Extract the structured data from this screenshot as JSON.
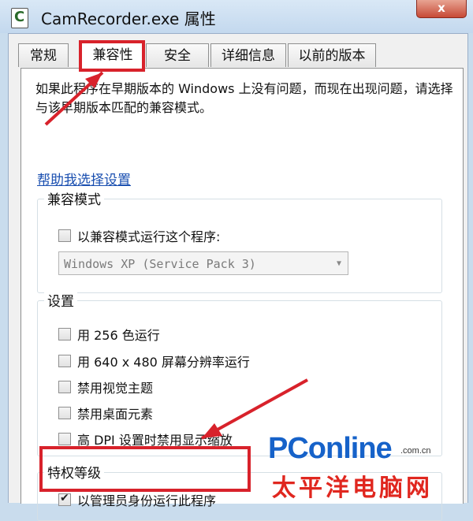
{
  "window": {
    "title": "CamRecorder.exe 属性",
    "close_label": "x",
    "app_icon_glyph": "C"
  },
  "tabs": [
    {
      "label": "常规",
      "active": false
    },
    {
      "label": "兼容性",
      "active": true
    },
    {
      "label": "安全",
      "active": false
    },
    {
      "label": "详细信息",
      "active": false
    },
    {
      "label": "以前的版本",
      "active": false
    }
  ],
  "intro_text": "如果此程序在早期版本的 Windows 上没有问题，而现在出现问题，请选择与该早期版本匹配的兼容模式。",
  "help_link": "帮助我选择设置",
  "compat_mode": {
    "label": "兼容模式",
    "checkbox_label": "以兼容模式运行这个程序:",
    "checked": false,
    "selected_os": "Windows XP (Service Pack 3)"
  },
  "settings": {
    "label": "设置",
    "items": [
      {
        "label": "用 256 色运行",
        "checked": false
      },
      {
        "label": "用 640 x 480 屏幕分辨率运行",
        "checked": false
      },
      {
        "label": "禁用视觉主题",
        "checked": false
      },
      {
        "label": "禁用桌面元素",
        "checked": false
      },
      {
        "label": "高 DPI 设置时禁用显示缩放",
        "checked": false
      }
    ]
  },
  "privilege": {
    "label": "特权等级",
    "checkbox_label": "以管理员身份运行此程序",
    "checked": true
  },
  "watermark": {
    "brand": "PConline",
    "domain": ".com.cn",
    "cn_name": "太平洋电脑网"
  },
  "colors": {
    "highlight": "#d8222b",
    "link": "#1a4fb0",
    "titlebar": "#c9dced"
  },
  "icons": [
    "app-icon",
    "close-icon",
    "checkbox",
    "chevron-down-icon",
    "annotation-arrow"
  ]
}
